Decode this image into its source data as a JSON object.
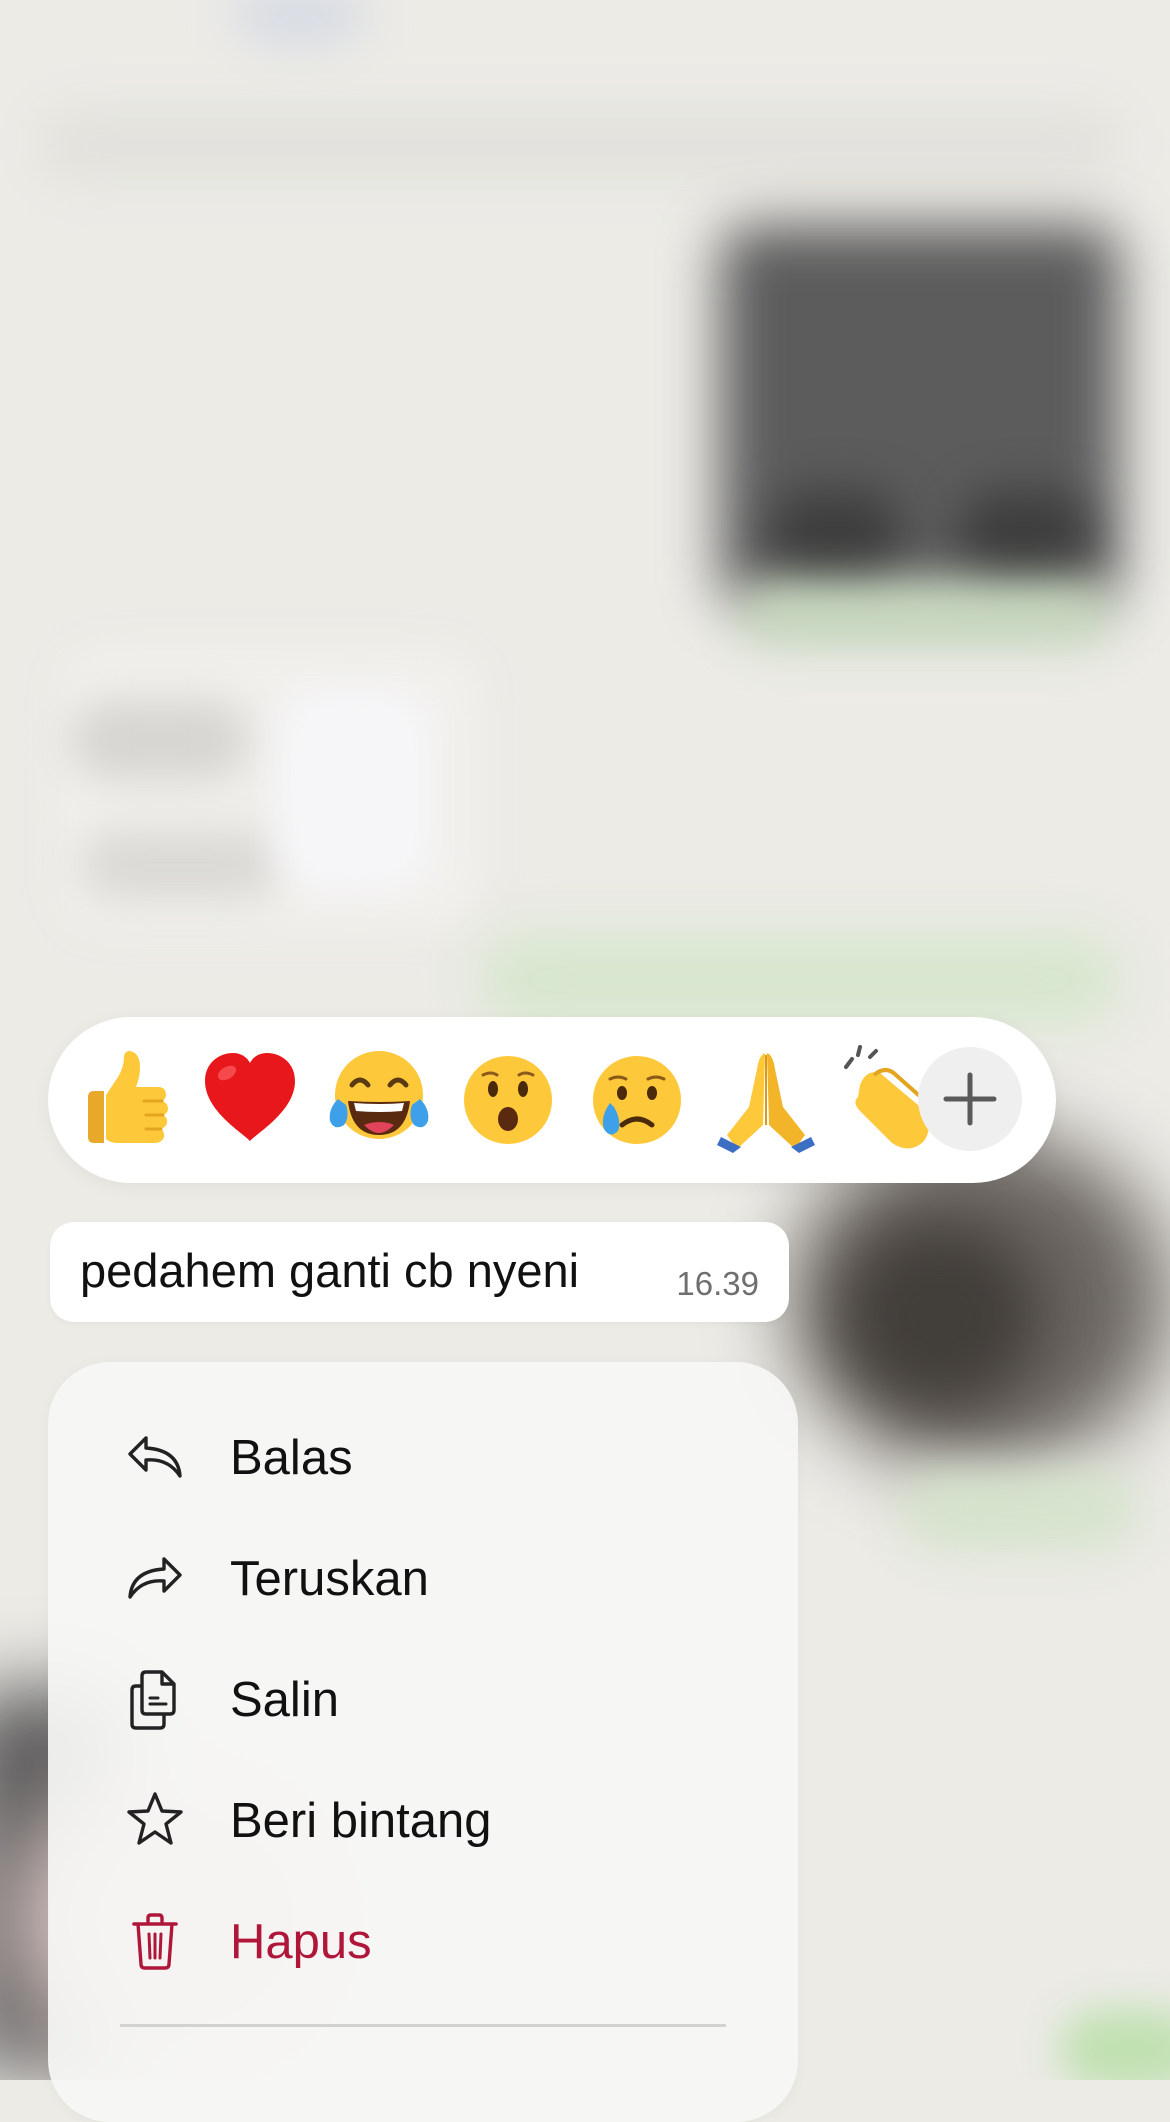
{
  "reactions": {
    "emojis": [
      {
        "char": "👍",
        "name": "thumbs-up"
      },
      {
        "char": "❤️",
        "name": "red-heart"
      },
      {
        "char": "😂",
        "name": "tears-of-joy"
      },
      {
        "char": "😮",
        "name": "open-mouth"
      },
      {
        "char": "😢",
        "name": "crying-face"
      },
      {
        "char": "🙏",
        "name": "folded-hands"
      },
      {
        "char": "👏",
        "name": "clapping-hands"
      }
    ],
    "more_icon": "plus-icon"
  },
  "message": {
    "text": "pedahem ganti cb nyeni",
    "time": "16.39"
  },
  "menu": {
    "items": [
      {
        "label": "Balas",
        "icon": "reply-icon"
      },
      {
        "label": "Teruskan",
        "icon": "forward-icon"
      },
      {
        "label": "Salin",
        "icon": "copy-icon"
      },
      {
        "label": "Beri bintang",
        "icon": "star-icon"
      },
      {
        "label": "Hapus",
        "icon": "trash-icon"
      }
    ]
  },
  "colors": {
    "background": "#ecebe6",
    "danger": "#b0163a",
    "menu_background": "#f6f6f5",
    "bubble_background": "#ffffff"
  }
}
